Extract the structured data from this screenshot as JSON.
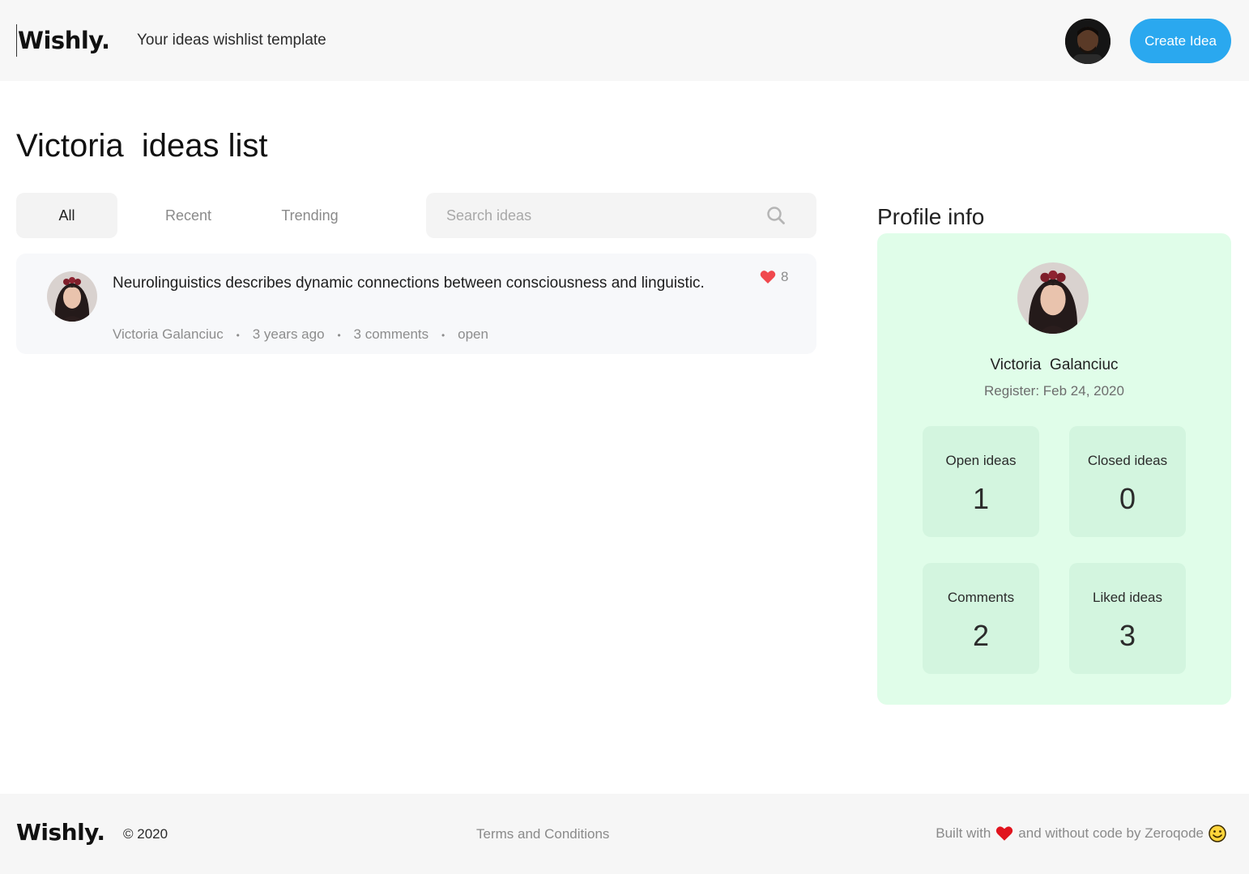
{
  "header": {
    "logo": "Wishly.",
    "tagline": "Your ideas wishlist template",
    "create_label": "Create Idea"
  },
  "page": {
    "title": "Victoria  ideas list"
  },
  "tabs": [
    {
      "label": "All",
      "active": true
    },
    {
      "label": "Recent",
      "active": false
    },
    {
      "label": "Trending",
      "active": false
    }
  ],
  "search": {
    "placeholder": "Search ideas",
    "value": ""
  },
  "ideas": [
    {
      "title": "Neurolinguistics describes dynamic connections between consciousness and linguistic.",
      "author": "Victoria  Galanciuc",
      "time": "3 years ago",
      "comments": "3 comments",
      "status": "open",
      "likes": "8"
    }
  ],
  "profile": {
    "heading": "Profile info",
    "name": "Victoria  Galanciuc",
    "register": "Register: Feb 24, 2020",
    "stats": [
      {
        "label": "Open ideas",
        "value": "1"
      },
      {
        "label": "Closed ideas",
        "value": "0"
      },
      {
        "label": "Comments",
        "value": "2"
      },
      {
        "label": "Liked ideas",
        "value": "3"
      }
    ]
  },
  "footer": {
    "logo": "Wishly.",
    "copyright": "© 2020",
    "terms": "Terms and Conditions",
    "built_prefix": "Built with",
    "built_suffix": "and without code by Zeroqode"
  },
  "colors": {
    "accent": "#2aa8ef",
    "heart": "#f0484d",
    "profile_bg": "#e0fde9",
    "stat_bg": "#d3f5df"
  },
  "icons": {
    "search": "search-icon",
    "like": "heart-icon",
    "footer_heart": "heart-icon",
    "smile": "smiley-icon"
  }
}
